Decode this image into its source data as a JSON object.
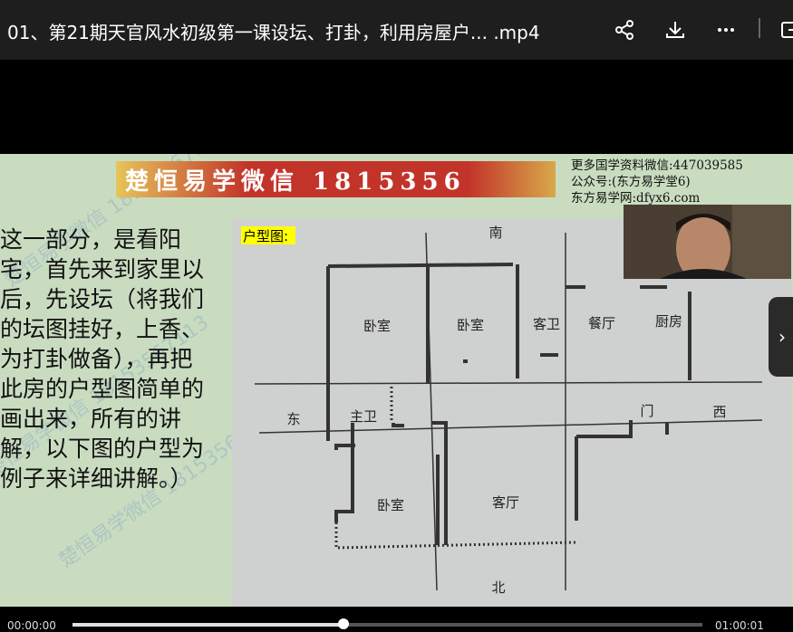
{
  "header": {
    "title": "01、第21期天官风水初级第一课设坛、打卦，利用房屋户... .mp4",
    "share_icon": "share-icon",
    "download_icon": "download-icon",
    "more_icon": "more-icon",
    "exit_icon": "exit-icon"
  },
  "slide": {
    "banner": "楚恒易学微信 1815356",
    "info_lines": [
      "更多国学资料微信:447039585",
      "公众号:(东方易学堂6)",
      "东方易学网:dfyx6.com"
    ],
    "text": "这一部分，是看阳宅，首先来到家里以后，先设坛（将我们的坛图挂好，上香、为打卦做备），再把此房的户型图简单的画出来，所有的讲解，以下图的户型为例子来详细讲解。）",
    "watermark": "楚恒易学微信 18153567113"
  },
  "plan": {
    "title": "户型图:",
    "south": "南",
    "north": "北",
    "east": "东",
    "west": "西",
    "rooms": {
      "bedroom1": "卧室",
      "bedroom2": "卧室",
      "guest_bath": "客卫",
      "dining": "餐厅",
      "kitchen": "厨房",
      "master_bath": "主卫",
      "bedroom3": "卧室",
      "living": "客厅",
      "door": "门"
    }
  },
  "player": {
    "time_current": "00:00:00",
    "time_total": "01:00:01",
    "progress": 0.43,
    "next_icon": "chevron-right-icon"
  }
}
